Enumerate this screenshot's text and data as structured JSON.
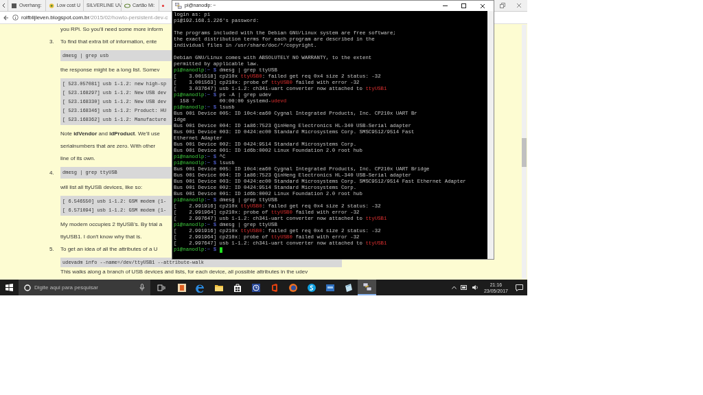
{
  "browser": {
    "tabs": [
      {
        "title": "Overhang:",
        "kind": "cube"
      },
      {
        "title": "Low cost U",
        "kind": "flower"
      },
      {
        "title": "SILVERLINE UV",
        "kind": "none"
      },
      {
        "title": "Cartão Mi:",
        "kind": "swirl"
      },
      {
        "kind": "video"
      }
    ],
    "address": {
      "host": "rolfblijleven.blogspot.com.br",
      "path": "/2015/02/howto-persistent-dev-c"
    },
    "article": [
      {
        "kind": "para",
        "text": "you RPi. So you'll need some more inform"
      },
      {
        "kind": "step",
        "number": "3.",
        "text": "To find that extra bit of information, ente"
      },
      {
        "kind": "code",
        "lines": [
          "dmesg | grep usb"
        ]
      },
      {
        "kind": "para",
        "text": "the response might be a long list. Somev"
      },
      {
        "kind": "code",
        "lines": [
          "[ 523.057081] usb 1-1.2: new high-sp",
          "[ 523.168297] usb 1-1.2: New USB dev",
          "[ 523.168330] usb 1-1.2: New USB dev",
          "[ 523.168346] usb 1-1.2: Product: HU",
          "[ 523.168362] usb 1-1.2: Manufacture"
        ]
      },
      {
        "kind": "para",
        "text": "Note **idVendor** and **idProduct**. We'll use"
      },
      {
        "kind": "para",
        "text": "serialnumbers that are zero. With other"
      },
      {
        "kind": "para",
        "text": "line of its own."
      },
      {
        "kind": "step_code",
        "number": "4.",
        "text": "dmesg | grep ttyUSB"
      },
      {
        "kind": "para",
        "text": "will list all ttyUSB devices, like so:"
      },
      {
        "kind": "code",
        "lines": [
          "[ 6.546550] usb 1-1.2: GSM modem (1-",
          "[ 6.571094] usb 1-1.2: GSM modem (1-"
        ]
      },
      {
        "kind": "para",
        "text": "My modem occupies 2 ttyUSB's. By trial a"
      },
      {
        "kind": "para",
        "text": "ttyUSB1. I don't know why that is."
      },
      {
        "kind": "step",
        "number": "5.",
        "text": "To get an idea of all the attributes of a U"
      },
      {
        "kind": "widecode",
        "lines": [
          "udevadm info --name=/dev/ttyUSB1 --attribute-walk"
        ]
      },
      {
        "kind": "widepara",
        "text": "This walks along a branch of USB devices and lists, for each device, all possible attributes in the udev"
      }
    ]
  },
  "terminal": {
    "title": "pi@nanodlp: ~",
    "lines": [
      {
        "segments": [
          {
            "t": "login as: pi",
            "kind": "text"
          }
        ]
      },
      {
        "segments": [
          {
            "t": "pi@192.168.1.226's password:",
            "kind": "text"
          }
        ]
      },
      {
        "spaced": true,
        "segments": [
          {
            "t": "The programs included with the Debian GNU/Linux system are free software;",
            "kind": "text"
          }
        ]
      },
      {
        "segments": [
          {
            "t": "the exact distribution terms for each program are described in the",
            "kind": "text"
          }
        ]
      },
      {
        "segments": [
          {
            "t": "individual files in /usr/share/doc/*/copyright.",
            "kind": "text"
          }
        ]
      },
      {
        "spaced": true,
        "segments": [
          {
            "t": "Debian GNU/Linux comes with ABSOLUTELY NO WARRANTY, to the extent",
            "kind": "text"
          }
        ]
      },
      {
        "segments": [
          {
            "t": "permitted by applicable law.",
            "kind": "text"
          }
        ]
      },
      {
        "segments": [
          {
            "t": "pi@nanodlp",
            "kind": "user"
          },
          {
            "t": ":~ $",
            "kind": "path"
          },
          {
            "t": " dmesg | grep ttyUSB",
            "kind": "text"
          }
        ]
      },
      {
        "segments": [
          {
            "t": "[    3.001518] cp210x ",
            "kind": "text"
          },
          {
            "t": "ttyUSB0",
            "kind": "highlight"
          },
          {
            "t": ": failed get req 0x4 size 2 status: -32",
            "kind": "text"
          }
        ]
      },
      {
        "segments": [
          {
            "t": "[    3.001563] cp210x: probe of ",
            "kind": "text"
          },
          {
            "t": "ttyUSB0",
            "kind": "highlight"
          },
          {
            "t": " failed with error -32",
            "kind": "text"
          }
        ]
      },
      {
        "segments": [
          {
            "t": "[    3.037647] usb 1-1.2: ch341-uart converter now attached to ",
            "kind": "text"
          },
          {
            "t": "ttyUSB1",
            "kind": "highlight"
          }
        ]
      },
      {
        "segments": [
          {
            "t": "pi@nanodlp",
            "kind": "user"
          },
          {
            "t": ":~ $",
            "kind": "path"
          },
          {
            "t": " ps -A | grep udev",
            "kind": "text"
          }
        ]
      },
      {
        "segments": [
          {
            "t": "  158 ?        00:00:00 systemd-",
            "kind": "text"
          },
          {
            "t": "udevd",
            "kind": "highlight"
          }
        ]
      },
      {
        "segments": [
          {
            "t": "pi@nanodlp",
            "kind": "user"
          },
          {
            "t": ":~ $",
            "kind": "path"
          },
          {
            "t": " lsusb",
            "kind": "text"
          }
        ]
      },
      {
        "segments": [
          {
            "t": "Bus 001 Device 005: ID 10c4:ea60 Cygnal Integrated Products, Inc. CP210x UART Br",
            "kind": "text"
          }
        ]
      },
      {
        "segments": [
          {
            "t": "idge",
            "kind": "text"
          }
        ]
      },
      {
        "segments": [
          {
            "t": "Bus 001 Device 004: ID 1a86:7523 QinHeng Electronics HL-340 USB-Serial adapter",
            "kind": "text"
          }
        ]
      },
      {
        "segments": [
          {
            "t": "Bus 001 Device 003: ID 0424:ec00 Standard Microsystems Corp. SMSC9512/9514 Fast",
            "kind": "text"
          }
        ]
      },
      {
        "segments": [
          {
            "t": "Ethernet Adapter",
            "kind": "text"
          }
        ]
      },
      {
        "segments": [
          {
            "t": "Bus 001 Device 002: ID 0424:9514 Standard Microsystems Corp.",
            "kind": "text"
          }
        ]
      },
      {
        "segments": [
          {
            "t": "Bus 001 Device 001: ID 1d6b:0002 Linux Foundation 2.0 root hub",
            "kind": "text"
          }
        ]
      },
      {
        "segments": [
          {
            "t": "pi@nanodlp",
            "kind": "user"
          },
          {
            "t": ":~ $",
            "kind": "path"
          },
          {
            "t": " ^C",
            "kind": "text"
          }
        ]
      },
      {
        "segments": [
          {
            "t": "pi@nanodlp",
            "kind": "user"
          },
          {
            "t": ":~ $",
            "kind": "path"
          },
          {
            "t": " lsusb",
            "kind": "text"
          }
        ]
      },
      {
        "segments": [
          {
            "t": "Bus 001 Device 005: ID 10c4:ea60 Cygnal Integrated Products, Inc. CP210x UART Bridge",
            "kind": "text"
          }
        ]
      },
      {
        "segments": [
          {
            "t": "Bus 001 Device 004: ID 1a86:7523 QinHeng Electronics HL-340 USB-Serial adapter",
            "kind": "text"
          }
        ]
      },
      {
        "segments": [
          {
            "t": "Bus 001 Device 003: ID 0424:ec00 Standard Microsystems Corp. SMSC9512/9514 Fast Ethernet Adapter",
            "kind": "text"
          }
        ]
      },
      {
        "segments": [
          {
            "t": "Bus 001 Device 002: ID 0424:9514 Standard Microsystems Corp.",
            "kind": "text"
          }
        ]
      },
      {
        "segments": [
          {
            "t": "Bus 001 Device 001: ID 1d6b:0002 Linux Foundation 2.0 root hub",
            "kind": "text"
          }
        ]
      },
      {
        "segments": [
          {
            "t": "pi@nanodlp",
            "kind": "user"
          },
          {
            "t": ":~ $",
            "kind": "path"
          },
          {
            "t": " dmesg | grep ttyUSB",
            "kind": "text"
          }
        ]
      },
      {
        "segments": [
          {
            "t": "[    2.991916] cp210x ",
            "kind": "text"
          },
          {
            "t": "ttyUSB0",
            "kind": "highlight"
          },
          {
            "t": ": failed get req 0x4 size 2 status: -32",
            "kind": "text"
          }
        ]
      },
      {
        "segments": [
          {
            "t": "[    2.991964] cp210x: probe of ",
            "kind": "text"
          },
          {
            "t": "ttyUSB0",
            "kind": "highlight"
          },
          {
            "t": " failed with error -32",
            "kind": "text"
          }
        ]
      },
      {
        "segments": [
          {
            "t": "[    2.997647] usb 1-1.2: ch341-uart converter now attached to ",
            "kind": "text"
          },
          {
            "t": "ttyUSB1",
            "kind": "highlight"
          }
        ]
      },
      {
        "segments": [
          {
            "t": "pi@nanodlp",
            "kind": "user"
          },
          {
            "t": ":~ $",
            "kind": "path"
          },
          {
            "t": " dmesg | grep ttyUSB",
            "kind": "text"
          }
        ]
      },
      {
        "segments": [
          {
            "t": "[    2.991916] cp210x ",
            "kind": "text"
          },
          {
            "t": "ttyUSB0",
            "kind": "highlight"
          },
          {
            "t": ": failed get req 0x4 size 2 status: -32",
            "kind": "text"
          }
        ]
      },
      {
        "segments": [
          {
            "t": "[    2.991964] cp210x: probe of ",
            "kind": "text"
          },
          {
            "t": "ttyUSB0",
            "kind": "highlight"
          },
          {
            "t": " failed with error -32",
            "kind": "text"
          }
        ]
      },
      {
        "segments": [
          {
            "t": "[    2.997647] usb 1-1.2: ch341-uart converter now attached to ",
            "kind": "text"
          },
          {
            "t": "ttyUSB1",
            "kind": "highlight"
          }
        ]
      },
      {
        "cursor": true,
        "segments": [
          {
            "t": "pi@nanodlp",
            "kind": "user"
          },
          {
            "t": ":~ $",
            "kind": "path"
          }
        ]
      }
    ]
  },
  "taskbar": {
    "search": {
      "placeholder": "Digite aqui para pesquisar"
    },
    "apps": [
      {
        "kind": "contacts",
        "selected": false
      },
      {
        "kind": "edge",
        "selected": false
      },
      {
        "kind": "folder",
        "selected": false
      },
      {
        "kind": "store",
        "selected": false
      },
      {
        "kind": "clock",
        "selected": false
      },
      {
        "kind": "office",
        "selected": false
      },
      {
        "kind": "firefox",
        "selected": false
      },
      {
        "kind": "skype",
        "selected": false
      },
      {
        "kind": "up",
        "selected": false
      },
      {
        "kind": "notes",
        "selected": false
      },
      {
        "kind": "putty",
        "selected": true
      }
    ],
    "time": "21:16",
    "date": "23/05/2017"
  }
}
